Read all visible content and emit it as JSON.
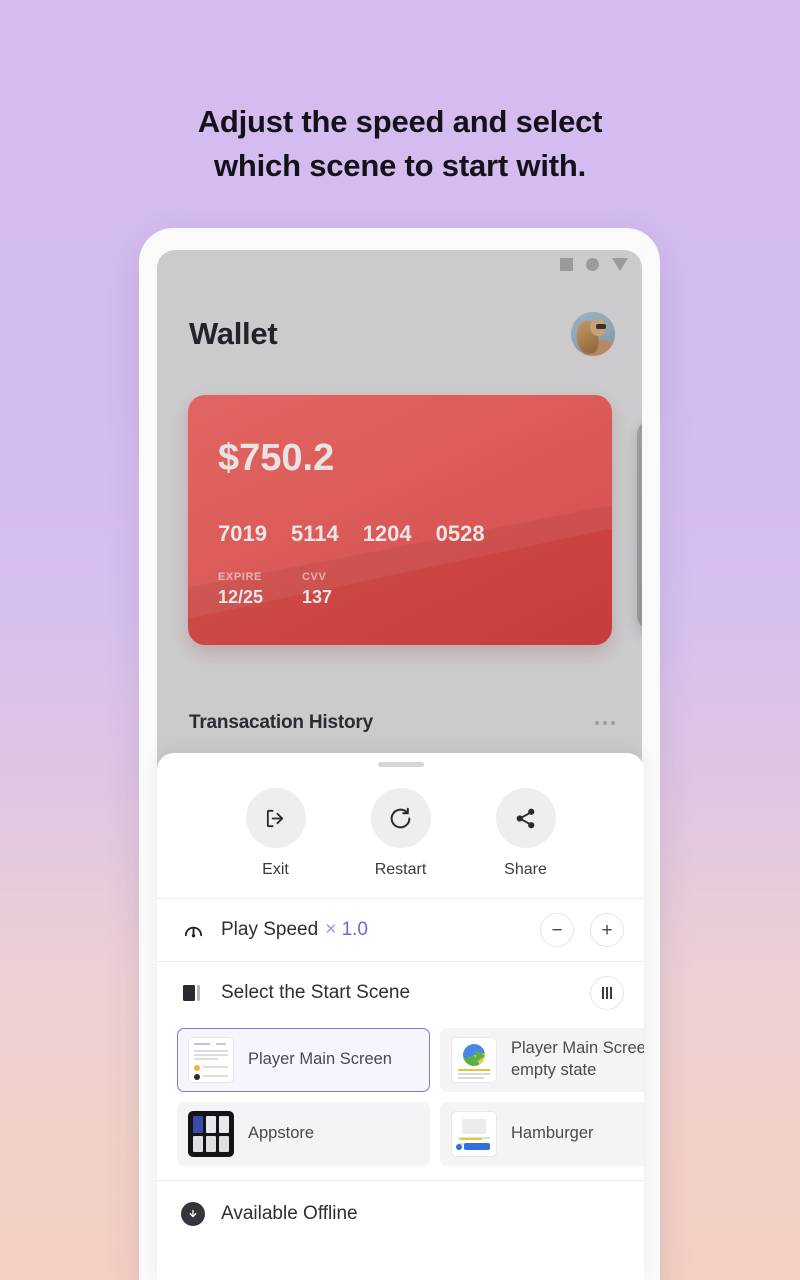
{
  "headline": {
    "line1": "Adjust the speed and select",
    "line2": "which scene to start with."
  },
  "colors": {
    "accent_purple": "#7b61d8",
    "selected_border": "#8b72de",
    "card_red": "#d9504d",
    "bg_top": "#d4bcf0",
    "bg_bottom": "#f4cfc3"
  },
  "phone": {
    "statusbar": {
      "icons": [
        "square-icon",
        "circle-icon",
        "triangle-icon"
      ]
    },
    "wallet": {
      "title": "Wallet",
      "avatar_name": "user-avatar",
      "card": {
        "balance": "$750.2",
        "number_groups": [
          "7019",
          "5114",
          "1204",
          "0528"
        ],
        "expire_label": "EXPIRE",
        "expire_value": "12/25",
        "cvv_label": "CVV",
        "cvv_value": "137"
      },
      "transactions": {
        "title": "Transacation History",
        "menu_icon": "more-horizontal-icon"
      }
    }
  },
  "sheet": {
    "actions": [
      {
        "label": "Exit",
        "icon": "exit-icon"
      },
      {
        "label": "Restart",
        "icon": "restart-icon"
      },
      {
        "label": "Share",
        "icon": "share-icon"
      }
    ],
    "play_speed": {
      "icon": "speedometer-icon",
      "label": "Play Speed",
      "multiplier_symbol": "×",
      "value": "1.0",
      "decrease_label": "−",
      "increase_label": "+"
    },
    "start_scene": {
      "icon": "scene-icon",
      "label": "Select the Start Scene",
      "layout_toggle_icon": "columns-icon",
      "scenes": [
        {
          "name": "Player Main Screen",
          "selected": true,
          "thumb": "document-thumb"
        },
        {
          "name": "Player Main Screen empty state",
          "selected": false,
          "thumb": "pie-chart-thumb"
        },
        {
          "name": "Appstore",
          "selected": false,
          "thumb": "appstore-grid-thumb"
        },
        {
          "name": "Hamburger",
          "selected": false,
          "thumb": "hamburger-thumb"
        }
      ]
    },
    "offline": {
      "icon": "download-circle-icon",
      "label": "Available Offline"
    }
  }
}
